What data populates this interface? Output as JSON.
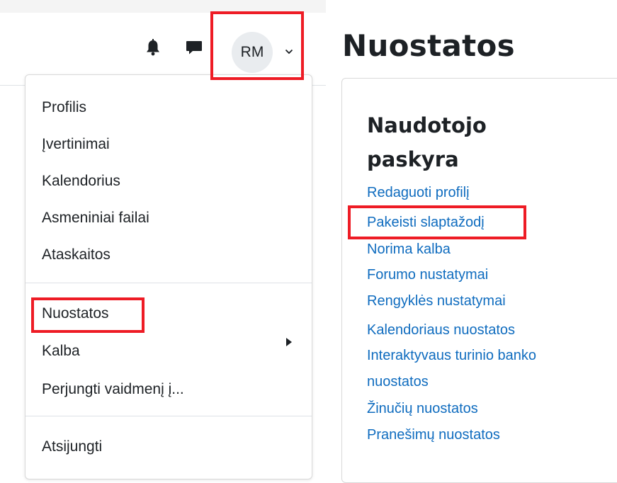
{
  "header": {
    "icons": {
      "notifications": "bell-icon",
      "messages": "chat-icon",
      "dropdown": "chevron-down-icon"
    },
    "user": {
      "initials": "RM"
    }
  },
  "user_menu": {
    "items": [
      "Profilis",
      "Įvertinimai",
      "Kalendorius",
      "Asmeniniai failai",
      "Ataskaitos"
    ],
    "settings": "Nuostatos",
    "language": "Kalba",
    "switch_role": "Perjungti vaidmenį į...",
    "logout": "Atsijungti"
  },
  "page": {
    "title": "Nuostatos",
    "section_title": "Naudotojo paskyra",
    "links": [
      "Redaguoti profilį",
      "Pakeisti slaptažodį",
      "Norima kalba",
      "Forumo nustatymai",
      "Rengyklės nustatymai",
      "Kalendoriaus nuostatos",
      "Interaktyvaus turinio banko",
      "nuostatos",
      "Žinučių nuostatos",
      "Pranešimų nuostatos"
    ]
  },
  "colors": {
    "link": "#0f6cbf",
    "highlight": "#ee1c25",
    "avatar_bg": "#e9ecef"
  }
}
